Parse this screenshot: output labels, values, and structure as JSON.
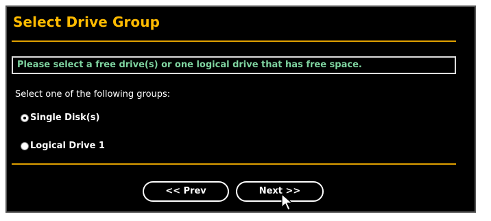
{
  "dialog": {
    "title": "Select Drive Group",
    "message": "Please select a free drive(s) or one logical drive that has free space.",
    "instruction": "Select one of the following groups:",
    "options": [
      {
        "label": "Single Disk(s)",
        "selected": true
      },
      {
        "label": "Logical Drive 1",
        "selected": false
      }
    ],
    "buttons": {
      "prev": "<< Prev",
      "next": "Next >>"
    }
  },
  "colors": {
    "background": "#000000",
    "title": "#ffbb00",
    "rule": "#e0a000",
    "message_text": "#7fd4a0",
    "text": "#ffffff"
  },
  "icons": {
    "cursor": "mouse-pointer-icon"
  }
}
